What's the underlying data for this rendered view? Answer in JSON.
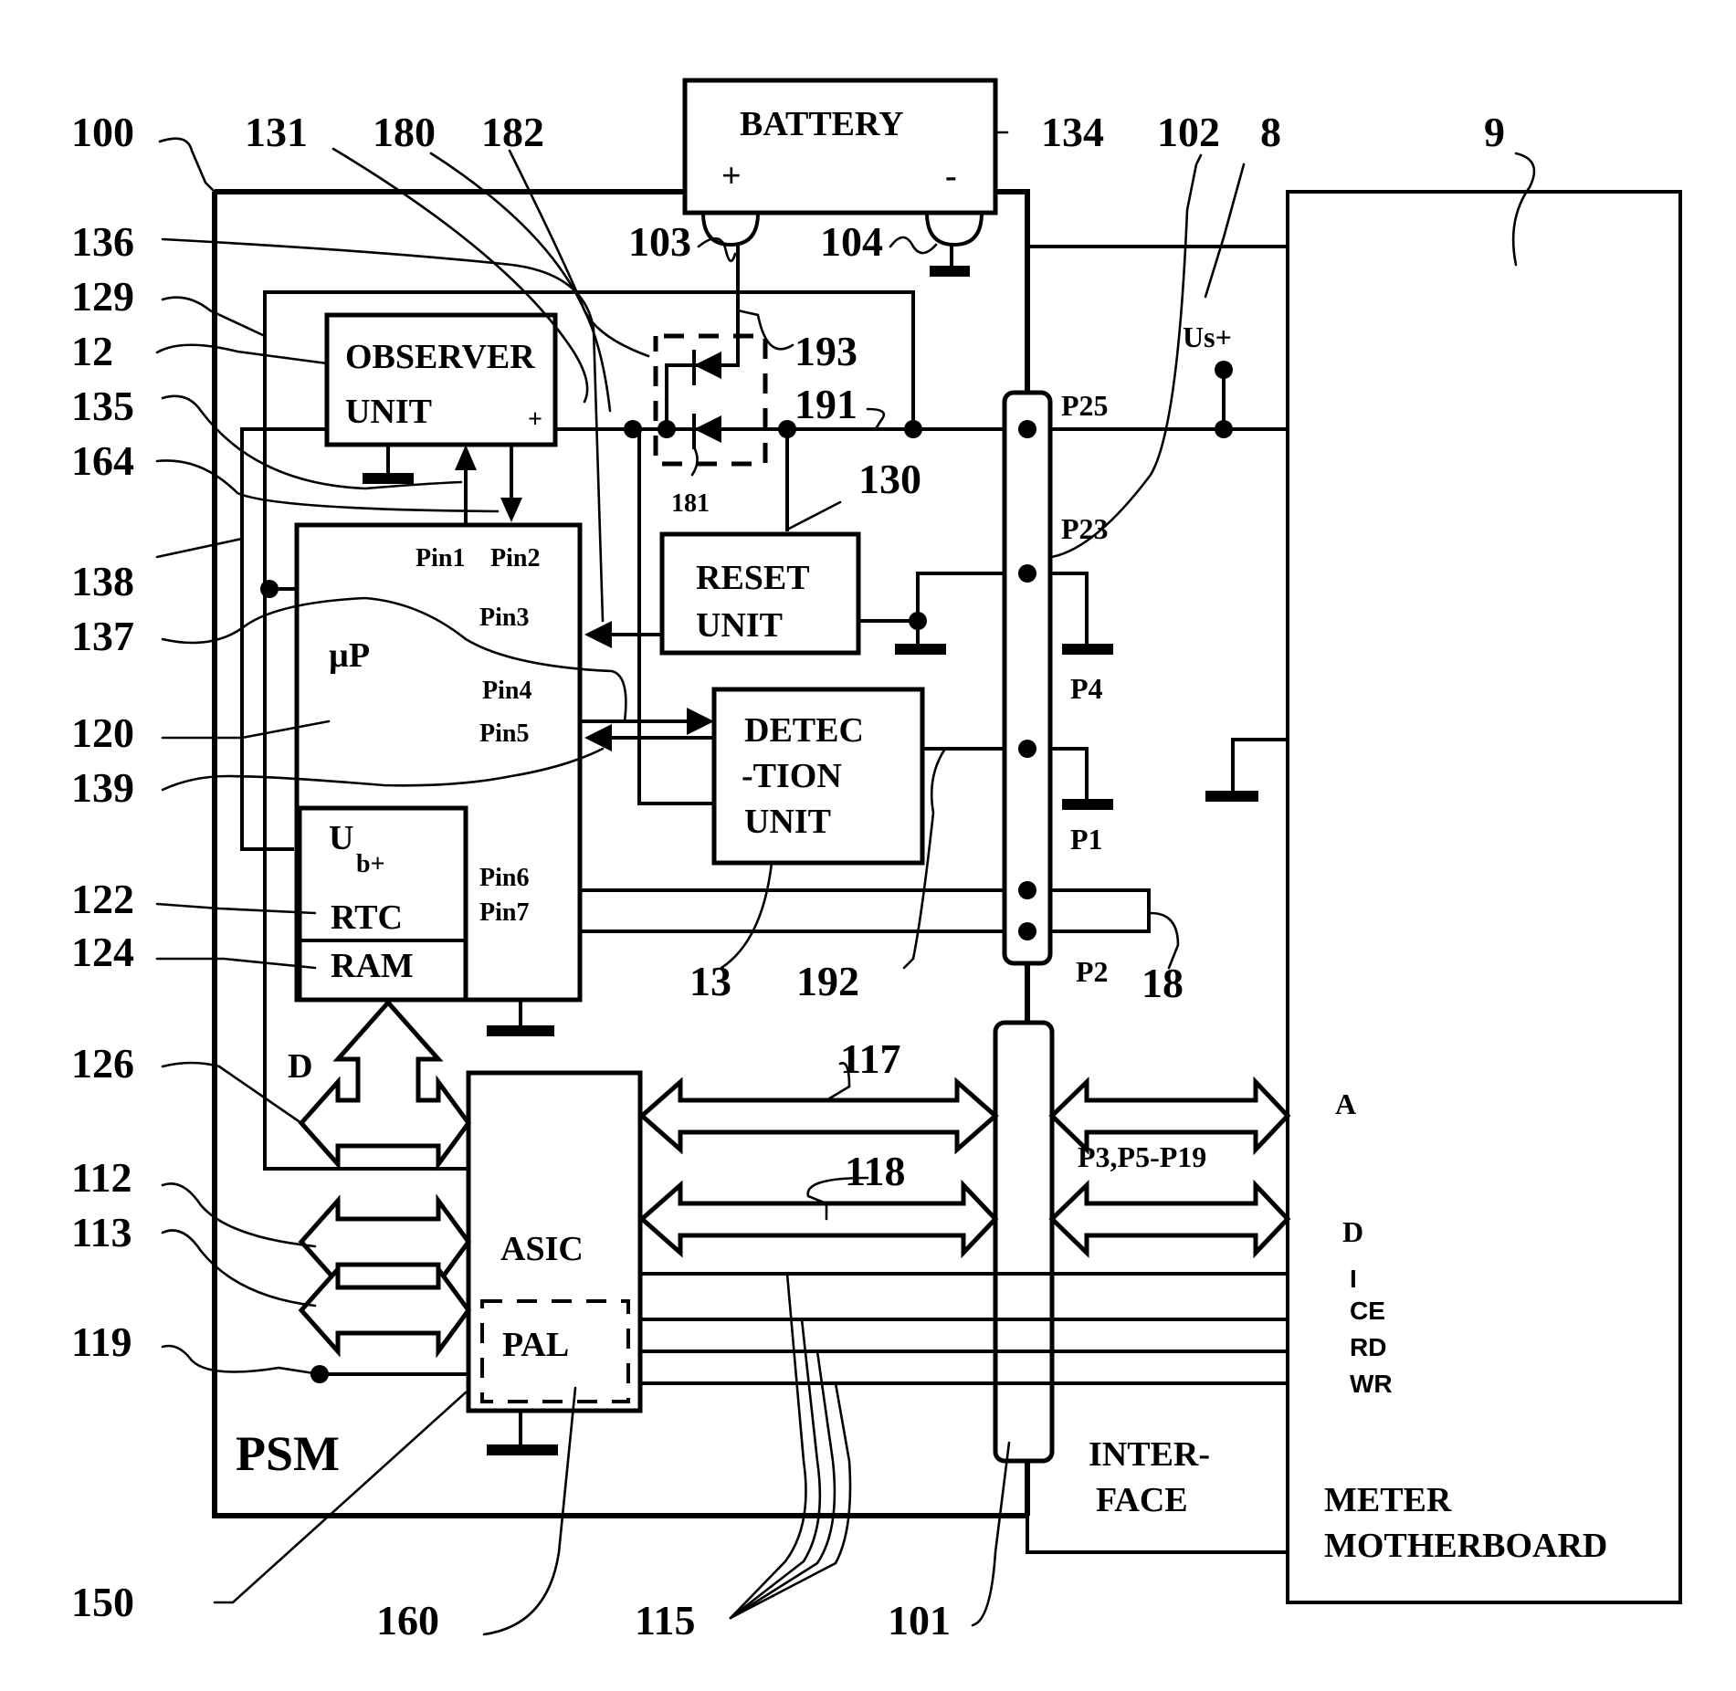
{
  "figure": {
    "type": "block-diagram",
    "description": "Power supply module (PSM) connected to meter motherboard via interface"
  },
  "blocks": {
    "battery": {
      "label": "BATTERY",
      "plus": "+",
      "minus": "-"
    },
    "observer": {
      "line1": "OBSERVER",
      "line2": "UNIT",
      "plus": "+"
    },
    "micro": {
      "label": "µP"
    },
    "reset": {
      "line1": "RESET",
      "line2": "UNIT"
    },
    "detection": {
      "line1": "DETEC",
      "line2": "-TION",
      "line3": "UNIT"
    },
    "rtc": {
      "u": "U",
      "sub": "b+",
      "rtc": "RTC",
      "ram": "RAM"
    },
    "asic": {
      "label": "ASIC",
      "pal": "PAL"
    },
    "psm": {
      "label": "PSM"
    },
    "interface": {
      "line1": "INTER-",
      "line2": "FACE"
    },
    "motherboard": {
      "line1": "METER",
      "line2": "MOTHERBOARD"
    }
  },
  "pins": [
    "Pin1",
    "Pin2",
    "Pin3",
    "Pin4",
    "Pin5",
    "Pin6",
    "Pin7"
  ],
  "ports": {
    "p25": "P25",
    "p23": "P23",
    "p4": "P4",
    "p1": "P1",
    "p2": "P2",
    "bus": "P3,P5-P19",
    "us": "Us+"
  },
  "signals": {
    "a": "A",
    "d": "D",
    "d_bus": "D",
    "i": "I",
    "ce": "CE",
    "rd": "RD",
    "wr": "WR"
  },
  "refs": {
    "r100": "100",
    "r131": "131",
    "r180": "180",
    "r182": "182",
    "r134": "134",
    "r102": "102",
    "r8": "8",
    "r9": "9",
    "r136": "136",
    "r129": "129",
    "r12": "12",
    "r135": "135",
    "r164": "164",
    "r138": "138",
    "r137": "137",
    "r120": "120",
    "r139": "139",
    "r122": "122",
    "r124": "124",
    "r126": "126",
    "r112": "112",
    "r113": "113",
    "r119": "119",
    "r150": "150",
    "r160": "160",
    "r115": "115",
    "r101": "101",
    "r103": "103",
    "r104": "104",
    "r193": "193",
    "r191": "191",
    "r181": "181",
    "r130": "130",
    "r13": "13",
    "r192": "192",
    "r18": "18",
    "r117": "117",
    "r118": "118"
  }
}
